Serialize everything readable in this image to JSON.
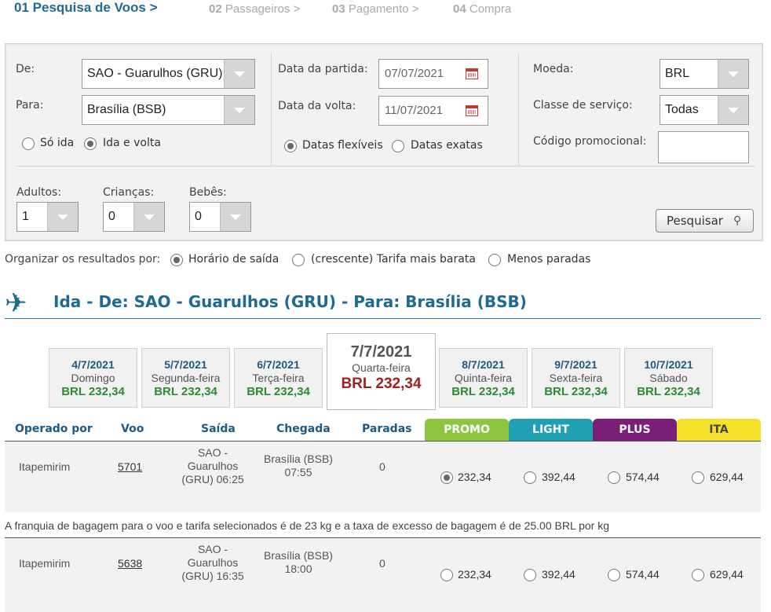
{
  "steps": [
    {
      "num": "01",
      "label": "Pesquisa de Voos >"
    },
    {
      "num": "02",
      "label": "Passageiros >"
    },
    {
      "num": "03",
      "label": "Pagamento >"
    },
    {
      "num": "04",
      "label": "Compra"
    }
  ],
  "search": {
    "from_label": "De:",
    "from_value": "SAO - Guarulhos (GRU)",
    "to_label": "Para:",
    "to_value": "Brasília (BSB)",
    "trip_one_way": "Só ida",
    "trip_round": "Ida e volta",
    "depart_label": "Data da partida:",
    "depart_value": "07/07/2021",
    "return_label": "Data da volta:",
    "return_value": "11/07/2021",
    "flex_dates": "Datas flexíveis",
    "exact_dates": "Datas exatas",
    "currency_label": "Moeda:",
    "currency_value": "BRL",
    "class_label": "Classe de serviço:",
    "class_value": "Todas",
    "promo_label": "Código promocional:",
    "promo_value": "",
    "adults_label": "Adultos:",
    "adults_value": "1",
    "children_label": "Crianças:",
    "children_value": "0",
    "infants_label": "Bebês:",
    "infants_value": "0",
    "search_button": "Pesquisar"
  },
  "sort": {
    "label": "Organizar os resultados por:",
    "options": [
      "Horário de saída",
      "(crescente) Tarifa mais barata",
      "Menos paradas"
    ]
  },
  "flight_header": "Ida - De: SAO - Guarulhos (GRU) - Para: Brasília (BSB)",
  "dates": [
    {
      "date": "4/7/2021",
      "day": "Domingo",
      "price": "BRL 232,34"
    },
    {
      "date": "5/7/2021",
      "day": "Segunda-feira",
      "price": "BRL 232,34"
    },
    {
      "date": "6/7/2021",
      "day": "Terça-feira",
      "price": "BRL 232,34"
    },
    {
      "date": "7/7/2021",
      "day": "Quarta-feira",
      "price": "BRL 232,34"
    },
    {
      "date": "8/7/2021",
      "day": "Quinta-feira",
      "price": "BRL 232,34"
    },
    {
      "date": "9/7/2021",
      "day": "Sexta-feira",
      "price": "BRL 232,34"
    },
    {
      "date": "10/7/2021",
      "day": "Sábado",
      "price": "BRL 232,34"
    }
  ],
  "columns": {
    "operator": "Operado por",
    "flight": "Voo",
    "depart": "Saída",
    "arrive": "Chegada",
    "stops": "Paradas"
  },
  "fares": [
    {
      "name": "PROMO",
      "color": "#8cc63f"
    },
    {
      "name": "LIGHT",
      "color": "#1fa0b4"
    },
    {
      "name": "PLUS",
      "color": "#7b1e7a"
    },
    {
      "name": "ITA",
      "color": "#f5e12a"
    }
  ],
  "flights": [
    {
      "operator": "Itapemirim",
      "number": "5701",
      "depart_l1": "SAO -",
      "depart_l2": "Guarulhos",
      "depart_l3": "(GRU) 06:25",
      "arrive_l1": "Brasília (BSB)",
      "arrive_l2": "07:55",
      "stops": "0",
      "prices": [
        "232,34",
        "392,44",
        "574,44",
        "629,44"
      ]
    },
    {
      "operator": "Itapemirim",
      "number": "5638",
      "depart_l1": "SAO -",
      "depart_l2": "Guarulhos",
      "depart_l3": "(GRU) 16:35",
      "arrive_l1": "Brasília (BSB)",
      "arrive_l2": "18:00",
      "stops": "0",
      "prices": [
        "232,34",
        "392,44",
        "574,44",
        "629,44"
      ]
    }
  ],
  "baggage_note": "A franquia de bagagem para o voo e tarifa selecionados é de 23 kg e a taxa de excesso de bagagem é de 25.00 BRL por kg"
}
